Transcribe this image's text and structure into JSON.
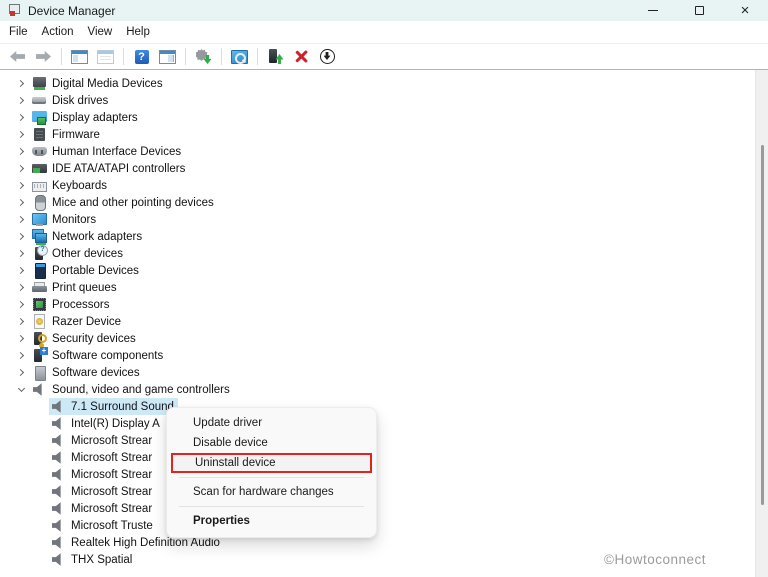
{
  "window": {
    "title": "Device Manager",
    "controls": [
      "minimize",
      "maximize",
      "close"
    ]
  },
  "menu": {
    "items": [
      "File",
      "Action",
      "View",
      "Help"
    ]
  },
  "toolbar": {
    "icons": [
      "back-arrow",
      "forward-arrow",
      "console-tree-window",
      "properties-window",
      "help",
      "action-pane-window",
      "update-gear",
      "scan-monitor",
      "device-up-arrow",
      "red-x",
      "disable-circle"
    ]
  },
  "tree": {
    "items": [
      {
        "label": "Digital Media Devices",
        "icon": "digital-media",
        "level": 0,
        "state": "collapsed"
      },
      {
        "label": "Disk drives",
        "icon": "disk",
        "level": 0,
        "state": "collapsed"
      },
      {
        "label": "Display adapters",
        "icon": "display",
        "level": 0,
        "state": "collapsed"
      },
      {
        "label": "Firmware",
        "icon": "firmware",
        "level": 0,
        "state": "collapsed"
      },
      {
        "label": "Human Interface Devices",
        "icon": "hid",
        "level": 0,
        "state": "collapsed"
      },
      {
        "label": "IDE ATA/ATAPI controllers",
        "icon": "ide",
        "level": 0,
        "state": "collapsed"
      },
      {
        "label": "Keyboards",
        "icon": "keyboard",
        "level": 0,
        "state": "collapsed"
      },
      {
        "label": "Mice and other pointing devices",
        "icon": "mouse",
        "level": 0,
        "state": "collapsed"
      },
      {
        "label": "Monitors",
        "icon": "monitor",
        "level": 0,
        "state": "collapsed"
      },
      {
        "label": "Network adapters",
        "icon": "network",
        "level": 0,
        "state": "collapsed"
      },
      {
        "label": "Other devices",
        "icon": "other",
        "level": 0,
        "state": "collapsed"
      },
      {
        "label": "Portable Devices",
        "icon": "portable",
        "level": 0,
        "state": "collapsed"
      },
      {
        "label": "Print queues",
        "icon": "printer",
        "level": 0,
        "state": "collapsed"
      },
      {
        "label": "Processors",
        "icon": "processor",
        "level": 0,
        "state": "collapsed"
      },
      {
        "label": "Razer Device",
        "icon": "razer",
        "level": 0,
        "state": "collapsed"
      },
      {
        "label": "Security devices",
        "icon": "security",
        "level": 0,
        "state": "collapsed"
      },
      {
        "label": "Software components",
        "icon": "software-component",
        "level": 0,
        "state": "collapsed"
      },
      {
        "label": "Software devices",
        "icon": "software-device",
        "level": 0,
        "state": "collapsed"
      },
      {
        "label": "Sound, video and game controllers",
        "icon": "speaker",
        "level": 0,
        "state": "expanded"
      },
      {
        "label": "7.1 Surround Sound",
        "icon": "speaker",
        "level": 1,
        "selected": true
      },
      {
        "label": "Intel(R) Display A",
        "icon": "speaker",
        "level": 1
      },
      {
        "label": "Microsoft Strear",
        "icon": "speaker",
        "level": 1
      },
      {
        "label": "Microsoft Strear",
        "icon": "speaker",
        "level": 1
      },
      {
        "label": "Microsoft Strear",
        "icon": "speaker",
        "level": 1
      },
      {
        "label": "Microsoft Strear",
        "icon": "speaker",
        "level": 1
      },
      {
        "label": "Microsoft Strear",
        "icon": "speaker",
        "level": 1
      },
      {
        "label": "Microsoft Truste",
        "icon": "speaker",
        "level": 1
      },
      {
        "label": "Realtek High Definition Audio",
        "icon": "speaker",
        "level": 1
      },
      {
        "label": "THX Spatial",
        "icon": "speaker",
        "level": 1
      }
    ]
  },
  "context_menu": {
    "items": [
      {
        "label": "Update driver"
      },
      {
        "label": "Disable device"
      },
      {
        "label": "Uninstall device",
        "annotated": true
      },
      {
        "label": "Scan for hardware changes"
      },
      {
        "label": "Properties",
        "bold": true
      }
    ]
  },
  "annotation": {
    "highlighted_item": "Uninstall device",
    "color": "#e32222"
  },
  "colors": {
    "titlebar_bg": "#e8f4f3",
    "selection": "#cde8f7",
    "menu_bg": "#f9f9f9",
    "watermark": "#9b9b9b"
  },
  "watermark": "©Howtoconnect"
}
